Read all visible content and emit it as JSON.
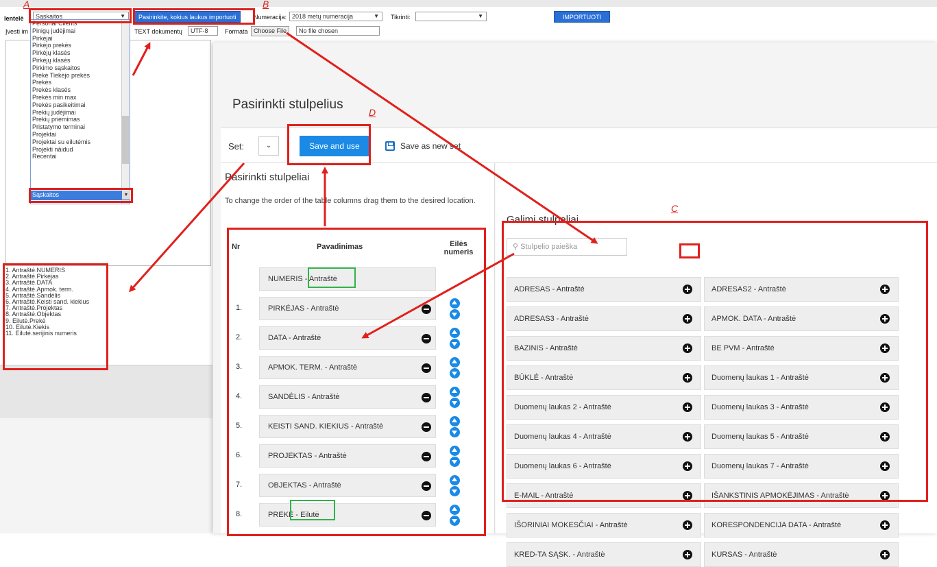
{
  "colors": {
    "accent": "#1a8ae6",
    "annotation_red": "#e0201c",
    "annotation_green": "#2fb34a"
  },
  "legacy": {
    "sablonas_label": "lentelė",
    "document_select": "Sąskaitos",
    "choose_fields_button": "Pasirinkite,  kokius laukus importuoti",
    "numeracija_label": "Numeracija:",
    "numeracija_value": "2018 metų numeracija",
    "tikrinti_label": "Tikrinti:",
    "import_button": "IMPORTUOTI",
    "ivesti_label": "Įvesti im",
    "encoding_label": "TEXT dokumentų",
    "encoding_value": "UTF-8",
    "format_label": "Formata",
    "choose_file_button": "Choose File",
    "no_file_text": "No file chosen",
    "dropdown_options": [
      "Personal Clients",
      "Pinigų judėjimai",
      "Pirkėjai",
      "Pirkėjo prekės",
      "Pirkėjų klasės",
      "Pirkėjų klasės",
      "Pirkimo sąskaitos",
      "Prekė Tiekėjo prekės",
      "Prekės",
      "Prekės klasės",
      "Prekės min max",
      "Prekės pasikeitimai",
      "Prekių judėjimai",
      "Prekių priėmimas",
      "Pristatymo terminai",
      "Projektai",
      "Projektai su eilutėmis",
      "Projekti nāidud",
      "Recentai"
    ],
    "dropdown_selected": "Sąskaitos",
    "selected_fields": [
      "1. Antraštė.NUMERIS",
      "2. Antraštė.Pirkėjas",
      "3. Antraštė.DATA",
      "4. Antraštė.Apmok. term.",
      "5. Antraštė.Sandėlis",
      "6. Antraštė.Keisti sand. kiekius",
      "7. Antraštė.Projektas",
      "8. Antraštė.Objektas",
      "9. Eilutė.Prekė",
      "10. Eilutė.Kiekis",
      "11. Eilutė.serijinis numeris"
    ]
  },
  "annotations": {
    "a": "A",
    "b": "B",
    "c": "C",
    "d": "D"
  },
  "modal": {
    "title": "Pasirinkti stulpelius",
    "set_label": "Set:",
    "save_and_use": "Save and use",
    "save_as_new_set": "Save as new set",
    "left_heading": "Pasirinkti stulpeliai",
    "hint": "To change the order of the table columns drag them to the desired location.",
    "col_nr": "Nr",
    "col_name": "Pavadinimas",
    "col_order": "Eilės numeris",
    "fixed_row": "NUMERIS - Antraštė",
    "selected_rows": [
      {
        "nr": "1.",
        "label": "PIRKĖJAS - Antraštė"
      },
      {
        "nr": "2.",
        "label": "DATA - Antraštė"
      },
      {
        "nr": "3.",
        "label": "APMOK. TERM. - Antraštė"
      },
      {
        "nr": "4.",
        "label": "SANDĖLIS - Antraštė"
      },
      {
        "nr": "5.",
        "label": "KEISTI SAND. KIEKIUS - Antraštė"
      },
      {
        "nr": "6.",
        "label": "PROJEKTAS - Antraštė"
      },
      {
        "nr": "7.",
        "label": "OBJEKTAS - Antraštė"
      },
      {
        "nr": "8.",
        "label": "PREKĖ - Eilutė"
      }
    ],
    "right_heading": "Galimi stulpeliai",
    "search_placeholder": "Stulpelio paieška",
    "available": [
      "ADRESAS - Antraštė",
      "ADRESAS2 - Antraštė",
      "ADRESAS3 - Antraštė",
      "APMOK. DATA - Antraštė",
      "BAZINIS - Antraštė",
      "BE PVM - Antraštė",
      "BŪKLĖ - Antraštė",
      "Duomenų laukas 1 - Antraštė",
      "Duomenų laukas 2 - Antraštė",
      "Duomenų laukas 3 - Antraštė",
      "Duomenų laukas 4 - Antraštė",
      "Duomenų laukas 5 - Antraštė",
      "Duomenų laukas 6 - Antraštė",
      "Duomenų laukas 7 - Antraštė",
      "E-MAIL - Antraštė",
      "IŠANKSTINIS APMOKĖJIMAS - Antraštė",
      "IŠORINIAI MOKESČIAI - Antraštė",
      "KORESPONDENCIJA DATA - Antraštė",
      "KRED-TA SĄSK. - Antraštė",
      "KURSAS - Antraštė"
    ]
  }
}
